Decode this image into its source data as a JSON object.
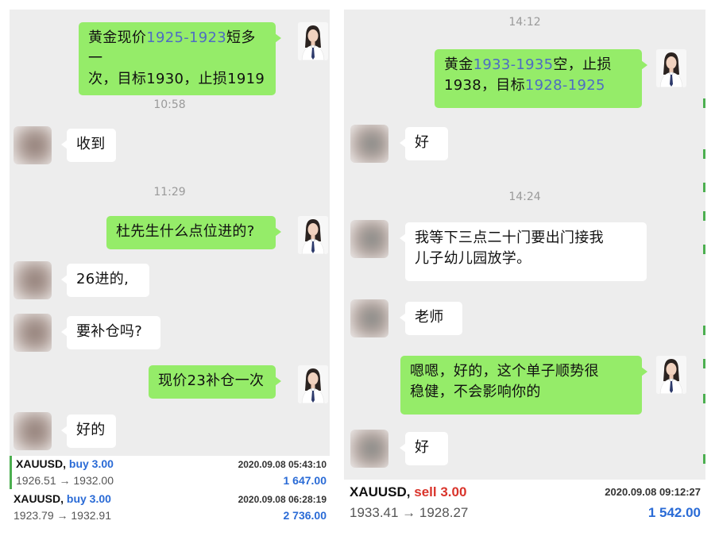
{
  "left": {
    "messages": [
      {
        "type": "me",
        "parts": [
          {
            "t": "黄金现价"
          },
          {
            "t": "1925-1923",
            "hl": true
          },
          {
            "t": "短多一\n次，目标1930，止损1919"
          }
        ]
      },
      {
        "type": "time",
        "text": "10:58"
      },
      {
        "type": "other",
        "parts": [
          {
            "t": "收到"
          }
        ]
      },
      {
        "type": "time",
        "text": "11:29"
      },
      {
        "type": "me",
        "parts": [
          {
            "t": "杜先生什么点位进的?"
          }
        ]
      },
      {
        "type": "other",
        "parts": [
          {
            "t": "26进的,"
          }
        ]
      },
      {
        "type": "other",
        "parts": [
          {
            "t": "要补仓吗?"
          }
        ]
      },
      {
        "type": "me",
        "parts": [
          {
            "t": "现价23补仓一次"
          }
        ]
      },
      {
        "type": "other",
        "parts": [
          {
            "t": "好的"
          }
        ]
      }
    ],
    "trades": [
      {
        "symbol": "XAUUSD,",
        "side": "buy 3.00",
        "side_type": "buy",
        "time": "2020.09.08 05:43:10",
        "prices": "1926.51 → 1932.00",
        "profit": "1 647.00"
      },
      {
        "symbol": "XAUUSD,",
        "side": "buy 3.00",
        "side_type": "buy",
        "time": "2020.09.08 06:28:19",
        "prices": "1923.79 → 1932.91",
        "profit": "2 736.00"
      }
    ]
  },
  "right": {
    "messages": [
      {
        "type": "time",
        "text": "14:12"
      },
      {
        "type": "me",
        "parts": [
          {
            "t": "黄金"
          },
          {
            "t": "1933-1935",
            "hl": true
          },
          {
            "t": "空，止损\n1938，目标"
          },
          {
            "t": "1928-1925",
            "hl": true
          }
        ]
      },
      {
        "type": "other",
        "parts": [
          {
            "t": "好"
          }
        ]
      },
      {
        "type": "time",
        "text": "14:24"
      },
      {
        "type": "other",
        "parts": [
          {
            "t": "我等下三点二十门要出门接我\n儿子幼儿园放学。"
          }
        ]
      },
      {
        "type": "other",
        "parts": [
          {
            "t": "老师"
          }
        ]
      },
      {
        "type": "me",
        "parts": [
          {
            "t": "嗯嗯，好的，这个单子顺势很\n稳健，不会影响你的"
          }
        ]
      },
      {
        "type": "other",
        "parts": [
          {
            "t": "好"
          }
        ]
      }
    ],
    "trades": [
      {
        "symbol": "XAUUSD,",
        "side": "sell 3.00",
        "side_type": "sell",
        "time": "2020.09.08 09:12:27",
        "prices": "1933.41 → 1928.27",
        "profit": "1 542.00"
      }
    ]
  },
  "colors": {
    "chat_bg": "#ededed",
    "my_bubble": "#95ec69",
    "their_bubble": "#ffffff",
    "highlight": "#4e6cc4",
    "buy": "#2a6bd6",
    "sell": "#d9342b",
    "profit": "#2a6bd6"
  },
  "icons": {
    "my_avatar": "woman-portrait-avatar",
    "their_avatar": "blurred-avatar"
  }
}
